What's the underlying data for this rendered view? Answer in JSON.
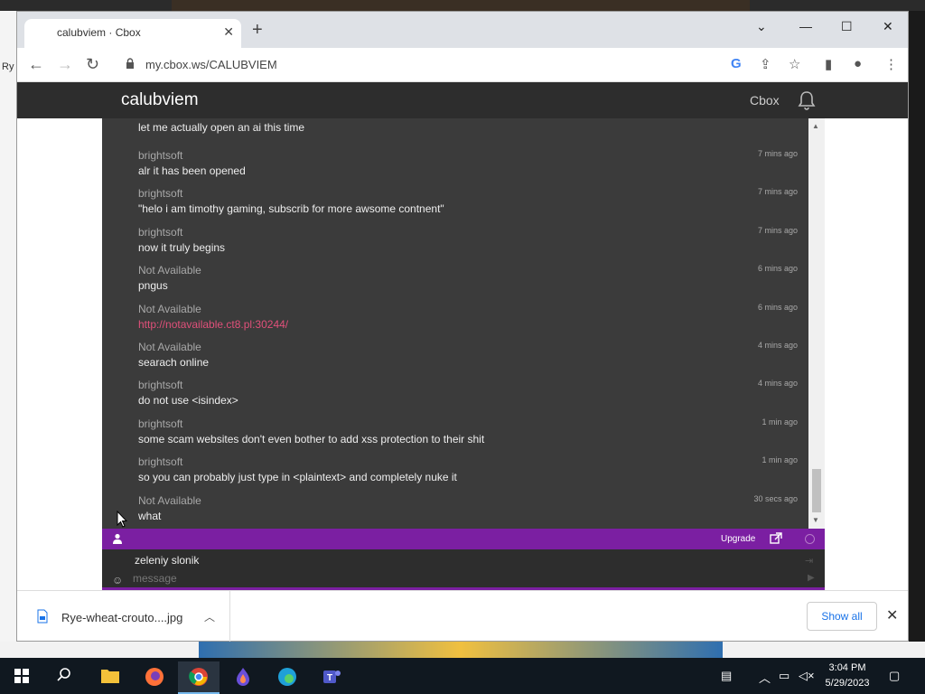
{
  "desktop": {
    "left_label": "Ry"
  },
  "browser": {
    "tab_title": "calubviem · Cbox",
    "url": "my.cbox.ws/CALUBVIEM"
  },
  "cbox": {
    "title": "calubviem",
    "header_link": "Cbox",
    "first_line": "let me actually open an ai this time",
    "messages": [
      {
        "name": "brightsoft",
        "time": "7 mins ago",
        "text": "alr it has been opened"
      },
      {
        "name": "brightsoft",
        "time": "7 mins ago",
        "text": "\"helo i am timothy gaming, subscrib for more awsome contnent\""
      },
      {
        "name": "brightsoft",
        "time": "7 mins ago",
        "text": "now it truly begins"
      },
      {
        "name": "Not Available",
        "time": "6 mins ago",
        "text": "pngus"
      },
      {
        "name": "Not Available",
        "time": "6 mins ago",
        "text": "http://notavailable.ct8.pl:30244/",
        "link": true
      },
      {
        "name": "Not Available",
        "time": "4 mins ago",
        "text": "searach online"
      },
      {
        "name": "brightsoft",
        "time": "4 mins ago",
        "text": "do not use <isindex>"
      },
      {
        "name": "brightsoft",
        "time": "1 min ago",
        "text": "some scam websites don't even bother to add xss protection to their shit"
      },
      {
        "name": "brightsoft",
        "time": "1 min ago",
        "text": "so you can probably just type in <plaintext> and completely nuke it"
      },
      {
        "name": "Not Available",
        "time": "30 secs ago",
        "text": "what"
      }
    ],
    "upgrade_label": "Upgrade",
    "username": "zeleniy slonik",
    "message_placeholder": "message"
  },
  "downloads": {
    "file_name": "Rye-wheat-crouto....jpg",
    "show_all_label": "Show all"
  },
  "taskbar": {
    "time": "3:04 PM",
    "date": "5/29/2023",
    "apps": [
      "file-explorer",
      "firefox",
      "chrome",
      "firefox-nightly",
      "edge",
      "teams"
    ]
  },
  "colors": {
    "cbox_header": "#2d2d2d",
    "chat_bg": "#3b3b3b",
    "accent_purple": "#7b1fa2",
    "link_pink": "#e0507a"
  }
}
